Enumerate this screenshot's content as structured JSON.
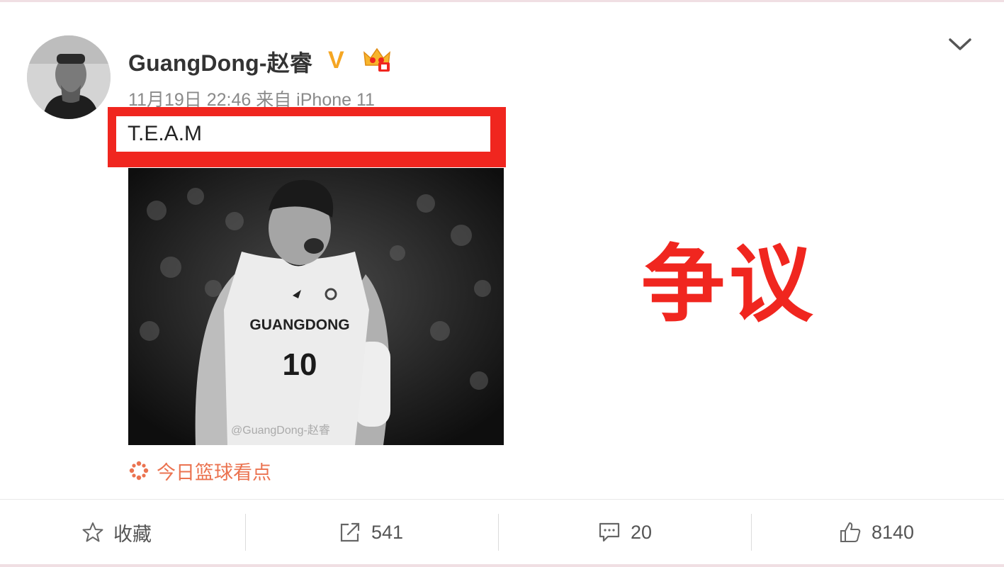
{
  "post": {
    "username": "GuangDong-赵睿",
    "verified_mark": "V",
    "timestamp": "11月19日 22:46",
    "source": "来自 iPhone 11",
    "text": "T.E.A.M",
    "photo": {
      "jersey_team": "GUANGDONG",
      "jersey_number": "10",
      "watermark": "@GuangDong-赵睿"
    },
    "overlay_label": "争议",
    "topic": "今日篮球看点"
  },
  "actions": {
    "favorite_label": "收藏",
    "repost_count": "541",
    "comment_count": "20",
    "like_count": "8140"
  },
  "colors": {
    "highlight_red": "#f0261f",
    "verified_gold": "#f5a623",
    "topic_orange": "#eb7350"
  },
  "icons": [
    "chevron-down-icon",
    "verified-icon",
    "crown-icon",
    "topic-icon",
    "star-icon",
    "repost-icon",
    "comment-icon",
    "thumbs-up-icon"
  ]
}
